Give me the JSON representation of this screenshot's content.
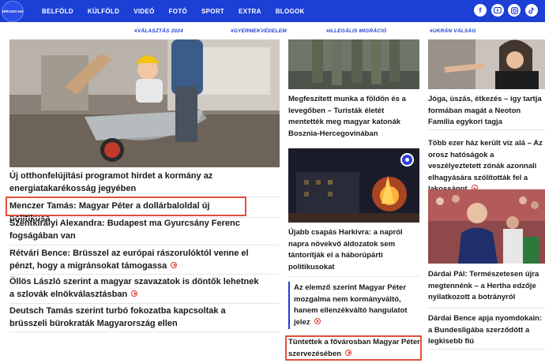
{
  "header": {
    "logo_text": "HIRADO.HU",
    "nav": [
      "BELFÖLD",
      "KÜLFÖLD",
      "VIDEÓ",
      "FOTÓ",
      "SPORT",
      "EXTRA",
      "BLOGOK"
    ],
    "social_icons": [
      "facebook-icon",
      "youtube-icon",
      "instagram-icon",
      "tiktok-icon"
    ],
    "nav_bg": "#1c3fd6"
  },
  "tags": [
    "#VÁLASZTÁS 2024",
    "#GYERMEKVÉDELEM",
    "#ILLEGÁLIS MIGRÁCIÓ",
    "#UKRÁN VÁLSÁG"
  ],
  "left": {
    "lead_title": "Új otthonfelújítási programot hirdet a kormány az energiatakarékosság jegyében",
    "items": [
      "Menczer Tamás: Magyar Péter a dollárbaloldal új politikusa",
      "Szentkirályi Alexandra: Budapest ma Gyurcsány Ferenc fogságában van",
      "Rétvári Bence: Brüsszel az európai rászorulóktól venne el pénzt, hogy a migránsokat támogassa",
      "Öllös László szerint a magyar szavazatok is döntők lehetnek a szlovák elnökválasztásban",
      "Deutsch Tamás szerint turbó fokozatba kapcsoltak a brüsszeli bürokraták Magyarország ellen"
    ]
  },
  "middle": {
    "item1": "Megfeszített munka a földön és a levegőben – Turisták életét mentették meg magyar katonák Bosznia-Hercegovinában",
    "item2": "Újabb csapás Harkivra: a napról napra növekvő áldozatok sem tántorítják el a háborúpárti politikusokat",
    "opinion": "Az elemző szerint Magyar Péter mozgalma nem kormányváltó, hanem ellenzékváltó hangulatot jelez",
    "item3": "Tüntettek a fővárosban Magyar Péter szervezésében"
  },
  "right": {
    "item1": "Jóga, úszás, étkezés – így tartja formában magát a Neoton Família egykori tagja",
    "item2": "Több ezer ház került víz alá – Az orosz hatóságok a veszélyeztetett zónák azonnali elhagyására szólították fel a lakosságot",
    "item3": "Dárdai Pál: Természetesen újra megtennénk – a Hertha edzője nyilatkozott a botrányról",
    "item4": "Dárdai Bence apja nyomdokain: a Bundesligába szerződött a legkisebb fiú"
  }
}
